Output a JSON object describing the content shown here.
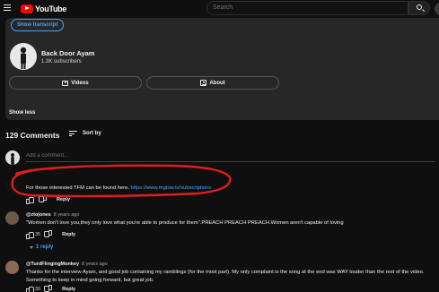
{
  "header": {
    "logo_text": "YouTube",
    "search_placeholder": "Search"
  },
  "description": {
    "transcript_button": "Show transcript",
    "channel_name": "Back Door Ayam",
    "subscribers": "1.3K subscribers",
    "videos_button": "Videos",
    "about_button": "About",
    "show_less": "Show less"
  },
  "comments_header": {
    "count_label": "129 Comments",
    "sort_label": "Sort by",
    "add_placeholder": "Add a comment..."
  },
  "comments": [
    {
      "author": "",
      "time": "",
      "text_prefix": "For those interested TFM can be found here. ",
      "link": "https://www.mgtow.tv/subscriptions",
      "likes": "",
      "reply_label": "Reply"
    },
    {
      "author": "@ztojones",
      "time": "8 years ago",
      "text": "\"Women don't love you,they only love what you're able to produce for them\".PREACH PREACH PREACH.Women aren't capable of loving",
      "likes": "35",
      "reply_label": "Reply",
      "replies_label": "1 reply"
    },
    {
      "author": "@TurdFlingingMonkey",
      "time": "8 years ago",
      "text_line1": "Thanks for the interview Ayam, and good job containing my ramblings (for the most part). My only complaint is the song at the end was WAY louder than the rest of the video.",
      "text_line2": "Something to keep in mind going forward, but great job.",
      "likes": "30",
      "reply_label": "Reply"
    }
  ],
  "colors": {
    "background": "#0f0f0f",
    "panel": "#272727",
    "link": "#3ea6ff",
    "annotation": "#e11d1d",
    "brand": "#ff0000"
  }
}
